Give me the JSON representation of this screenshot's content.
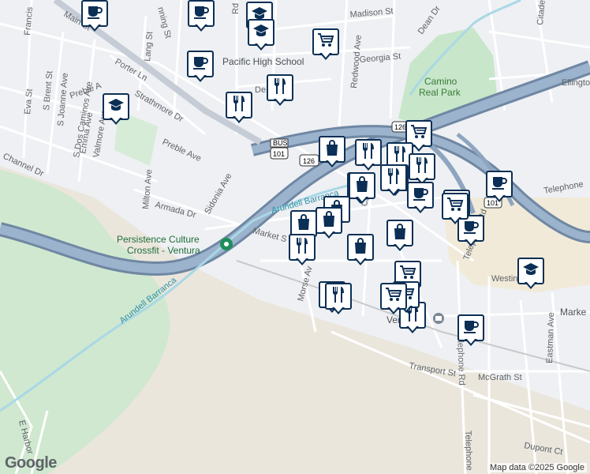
{
  "map": {
    "street_labels": {
      "main_st": "Main St",
      "francis": "Francis",
      "lang_st": "Lang St",
      "manning_st": "nning St",
      "rd_top": "Rd",
      "madison_st": "Madison St",
      "dean_dr": "Dean Dr",
      "citadel_ave": "Citadel Ave",
      "redwood_ave": "Redwood Ave",
      "georgia_st": "Georgia St",
      "ellington": "Ellingto",
      "porter_ln": "Porter Ln",
      "eva_st": "Eva St",
      "s_brent_st": "S Brent St",
      "s_joanne_ave": "S Joanne Ave",
      "preble_a": "Preble A",
      "strathmore_dr": "Strathmore Dr",
      "s_dos_caminos_ave": "S Dos Caminos Ave",
      "emma_ave": "Emma Ave",
      "valmore_ave": "Valmore Ave",
      "preble_ave": "Preble Ave",
      "channel_dr": "Channel Dr",
      "milton_ave": "Milton Ave",
      "armada_dr": "Armada Dr",
      "sidonia_ave": "Sidonia Ave",
      "market_st_left": "Market S",
      "callen": "Callen",
      "morse_av": "Morse Av",
      "telephone_rd_top": "Telephone",
      "telephone_rd_mid": "Telephone Rd",
      "telephone_rd_low": "Telephone Rd",
      "telephone_rd_bottom": "Telephone",
      "westinghouse": "Westinghous",
      "market_right": "Marke",
      "eastman_ave": "Eastman Ave",
      "mcgrath_st": "McGrath St",
      "transport_st": "Transport St",
      "dupont_ct": "Dupont Ct",
      "e_harbor": "E Harbor",
      "de_partial": "De"
    },
    "shields": {
      "bus101": "BUS",
      "r101": "101",
      "r126": "126",
      "r126b": "126",
      "r101b": "101"
    },
    "water": {
      "arundell_barranca_top": "Arundell Barranca",
      "arundell_barranca_low": "Arundell Barranca"
    },
    "places": {
      "pacific_high": "Pacific High School",
      "camino_real_park_1": "Camino",
      "camino_real_park_2": "Real Park",
      "crossfit_1": "Persistence Culture",
      "crossfit_2": "Crossfit - Ventura",
      "ventura": "Ventura"
    },
    "colors": {
      "background": "#eef0f3",
      "park": "#c8e6c9",
      "open_land": "#eae6dc",
      "industrial": "#f1ead8",
      "freeway": "#8ea5c0",
      "freeway_edge": "#6f87a3",
      "water": "#a9d8e6",
      "marker_border": "#0b2f55"
    },
    "markers": [
      {
        "type": "coffee"
      },
      {
        "type": "school"
      },
      {
        "type": "coffee"
      },
      {
        "type": "school"
      },
      {
        "type": "coffee"
      },
      {
        "type": "grocery"
      },
      {
        "type": "restaurant"
      },
      {
        "type": "restaurant"
      },
      {
        "type": "school"
      },
      {
        "type": "shopping"
      },
      {
        "type": "restaurant"
      },
      {
        "type": "grocery"
      },
      {
        "type": "restaurant"
      },
      {
        "type": "shopping"
      },
      {
        "type": "restaurant"
      },
      {
        "type": "restaurant"
      },
      {
        "type": "shopping"
      },
      {
        "type": "restaurant"
      },
      {
        "type": "coffee"
      },
      {
        "type": "coffee"
      },
      {
        "type": "shopping"
      },
      {
        "type": "grocery"
      },
      {
        "type": "shopping"
      },
      {
        "type": "shopping"
      },
      {
        "type": "coffee"
      },
      {
        "type": "grocery"
      },
      {
        "type": "shopping"
      },
      {
        "type": "restaurant"
      },
      {
        "type": "shopping"
      },
      {
        "type": "restaurant"
      },
      {
        "type": "grocery"
      },
      {
        "type": "restaurant"
      },
      {
        "type": "grocery"
      },
      {
        "type": "restaurant"
      },
      {
        "type": "grocery"
      },
      {
        "type": "coffee"
      },
      {
        "type": "school"
      }
    ],
    "attribution": "Map data ©2025 Google",
    "logo": "Google"
  }
}
